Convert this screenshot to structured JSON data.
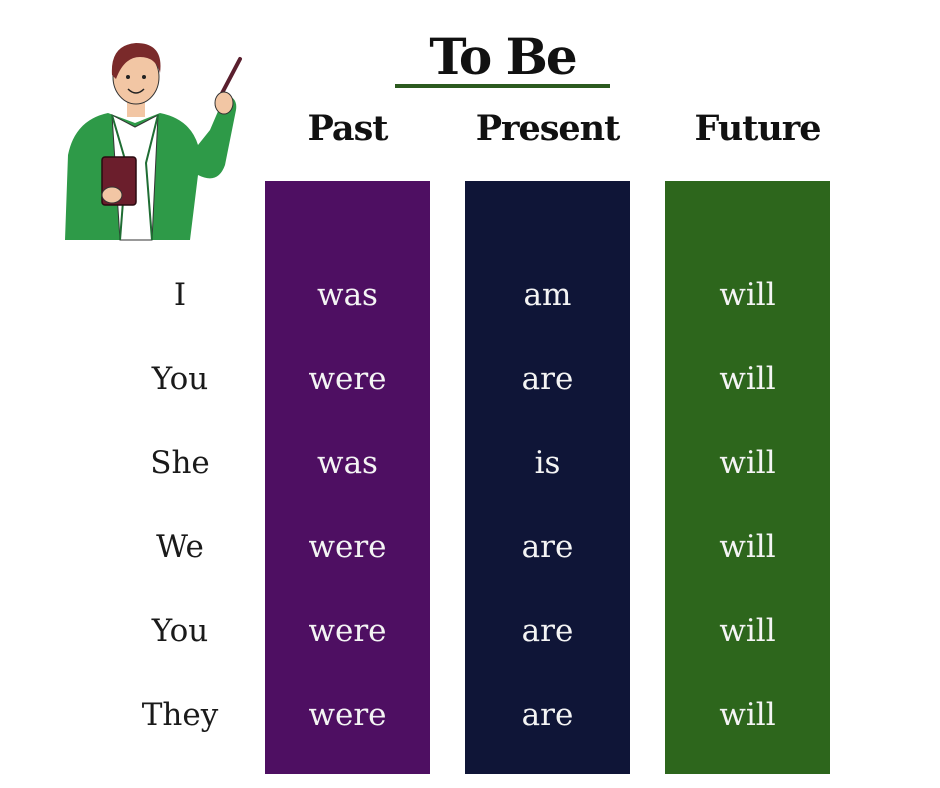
{
  "title": "To Be",
  "colors": {
    "past": "#4e0f62",
    "present": "#0f1537",
    "future": "#2d661c",
    "underline": "#2c5a1f",
    "teacher_jacket": "#2e9a48"
  },
  "headers": {
    "past": "Past",
    "present": "Present",
    "future": "Future"
  },
  "pronouns": [
    "I",
    "You",
    "She",
    "We",
    "You",
    "They"
  ],
  "past": [
    "was",
    "were",
    "was",
    "were",
    "were",
    "were"
  ],
  "present": [
    "am",
    "are",
    "is",
    "are",
    "are",
    "are"
  ],
  "future": [
    "will",
    "will",
    "will",
    "will",
    "will",
    "will"
  ],
  "illustration": {
    "name": "teacher-with-pointer-icon"
  }
}
